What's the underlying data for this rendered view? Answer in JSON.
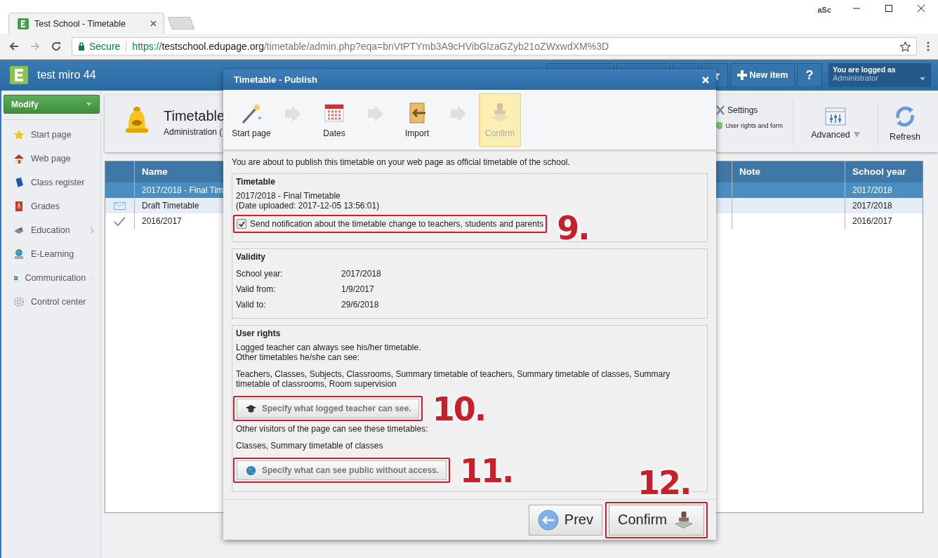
{
  "browser": {
    "tab_title": "Test School - Timetable",
    "profile_badge": "aSc",
    "secure_label": "Secure",
    "url_scheme": "https://",
    "url_host": "testschool.edupage.org",
    "url_path": "/timetable/admin.php?eqa=bnVtPTYmb3A9cHVibGlzaGZyb21oZWxwdXM%3D"
  },
  "header": {
    "school": "test miro 44",
    "new_item": "New item",
    "help": "?",
    "logged_as_label": "You are logged as",
    "user": "Administrator"
  },
  "sidebar": {
    "modify": "Modify",
    "items": [
      {
        "label": "Start page",
        "has_submenu": false
      },
      {
        "label": "Web page",
        "has_submenu": false
      },
      {
        "label": "Class register",
        "has_submenu": false
      },
      {
        "label": "Grades",
        "has_submenu": false
      },
      {
        "label": "Education",
        "has_submenu": true
      },
      {
        "label": "E-Learning",
        "has_submenu": false
      },
      {
        "label": "Communication",
        "has_submenu": true
      },
      {
        "label": "Control center",
        "has_submenu": false
      }
    ]
  },
  "toolbar": {
    "title": "Timetable",
    "subtitle": "Administration (",
    "settings": "Settings",
    "user_rights": "User rights and form",
    "advanced": "Advanced",
    "refresh": "Refresh"
  },
  "table": {
    "columns": [
      "Name",
      "Note",
      "School year"
    ],
    "rows": [
      {
        "name": "2017/2018 - Final Tim",
        "school_year": "2017/2018",
        "kind": "current",
        "selected": true
      },
      {
        "name": "Draft Timetable",
        "school_year": "2017/2018",
        "kind": "draft",
        "selected": false
      },
      {
        "name": "2016/2017",
        "school_year": "2016/2017",
        "kind": "published",
        "selected": false
      }
    ]
  },
  "dialog": {
    "title": "Timetable - Publish",
    "steps": [
      {
        "label": "Start page",
        "selected": false
      },
      {
        "label": "Dates",
        "selected": false
      },
      {
        "label": "Import",
        "selected": false
      },
      {
        "label": "Confirm",
        "selected": true
      }
    ],
    "intro": "You are about to publish this timetable on your web page as official timetable of the school.",
    "timetable_section": {
      "title": "Timetable",
      "name": "2017/2018 - Final Timetable",
      "uploaded": "(Date uploaded: 2017-12-05 13:56:01)",
      "notify": {
        "label": "Send notification about the timetable change to teachers, students and parents",
        "checked": true,
        "callout": "9."
      }
    },
    "validity_section": {
      "title": "Validity",
      "fields": [
        {
          "label": "School year:",
          "value": "2017/2018"
        },
        {
          "label": "Valid from:",
          "value": "1/9/2017"
        },
        {
          "label": "Valid to:",
          "value": "29/6/2018"
        }
      ]
    },
    "rights_section": {
      "title": "User rights",
      "teacher_note": [
        "Logged teacher can always see his/her timetable.",
        "Other timetables he/she can see:"
      ],
      "teacher_list": "Teachers, Classes, Subjects, Classrooms, Summary timetable of teachers, Summary timetable of classes, Summary timetable of classrooms, Room supervision",
      "teacher_button": {
        "label": "Specify what logged teacher can see.",
        "callout": "10."
      },
      "visitors_note": "Other visitors of the page can see these timetables:",
      "visitors_list": "Classes, Summary timetable of classes",
      "public_button": {
        "label": "Specify what can see public without access.",
        "callout": "11."
      }
    },
    "footer": {
      "prev": "Prev",
      "confirm": {
        "label": "Confirm",
        "callout": "12."
      }
    }
  }
}
